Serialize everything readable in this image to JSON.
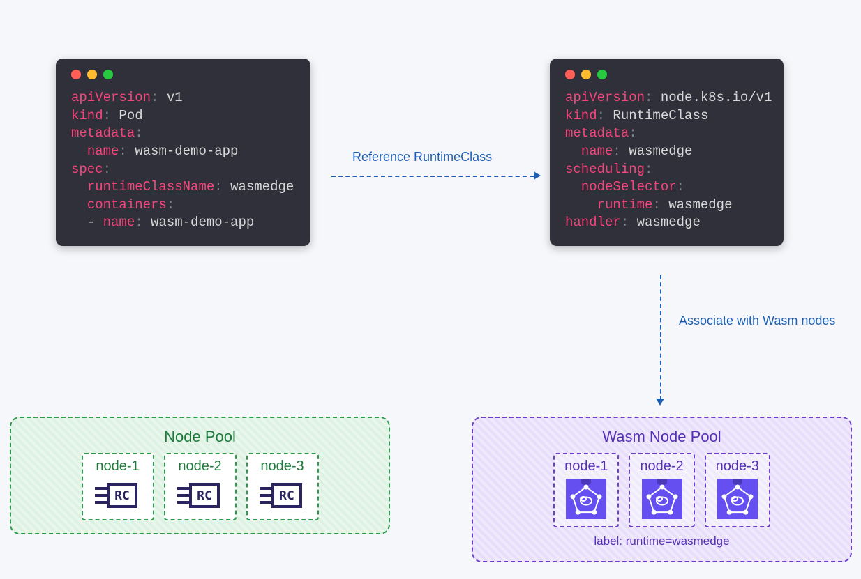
{
  "pod_yaml": {
    "lines": [
      [
        [
          "k",
          "apiVersion"
        ],
        [
          "c",
          ": "
        ],
        [
          "v",
          "v1"
        ]
      ],
      [
        [
          "k",
          "kind"
        ],
        [
          "c",
          ": "
        ],
        [
          "v",
          "Pod"
        ]
      ],
      [
        [
          "k",
          "metadata"
        ],
        [
          "c",
          ":"
        ]
      ],
      [
        [
          "v",
          "  "
        ],
        [
          "k",
          "name"
        ],
        [
          "c",
          ": "
        ],
        [
          "v",
          "wasm-demo-app"
        ]
      ],
      [
        [
          "k",
          "spec"
        ],
        [
          "c",
          ":"
        ]
      ],
      [
        [
          "v",
          "  "
        ],
        [
          "k",
          "runtimeClassName"
        ],
        [
          "c",
          ": "
        ],
        [
          "v",
          "wasmedge"
        ]
      ],
      [
        [
          "v",
          "  "
        ],
        [
          "k",
          "containers"
        ],
        [
          "c",
          ":"
        ]
      ],
      [
        [
          "v",
          "  - "
        ],
        [
          "k",
          "name"
        ],
        [
          "c",
          ": "
        ],
        [
          "v",
          "wasm-demo-app"
        ]
      ]
    ]
  },
  "runtimeclass_yaml": {
    "lines": [
      [
        [
          "k",
          "apiVersion"
        ],
        [
          "c",
          ": "
        ],
        [
          "v",
          "node.k8s.io/v1"
        ]
      ],
      [
        [
          "k",
          "kind"
        ],
        [
          "c",
          ": "
        ],
        [
          "v",
          "RuntimeClass"
        ]
      ],
      [
        [
          "k",
          "metadata"
        ],
        [
          "c",
          ":"
        ]
      ],
      [
        [
          "v",
          "  "
        ],
        [
          "k",
          "name"
        ],
        [
          "c",
          ": "
        ],
        [
          "v",
          "wasmedge"
        ]
      ],
      [
        [
          "k",
          "scheduling"
        ],
        [
          "c",
          ":"
        ]
      ],
      [
        [
          "v",
          "  "
        ],
        [
          "k",
          "nodeSelector"
        ],
        [
          "c",
          ":"
        ]
      ],
      [
        [
          "v",
          "    "
        ],
        [
          "k",
          "runtime"
        ],
        [
          "c",
          ": "
        ],
        [
          "v",
          "wasmedge"
        ]
      ],
      [
        [
          "k",
          "handler"
        ],
        [
          "c",
          ": "
        ],
        [
          "v",
          "wasmedge"
        ]
      ]
    ]
  },
  "arrows": {
    "reference_label": "Reference RuntimeClass",
    "associate_label": "Associate with Wasm nodes"
  },
  "green_pool": {
    "title": "Node Pool",
    "nodes": [
      "node-1",
      "node-2",
      "node-3"
    ],
    "icon_label": "RC"
  },
  "purple_pool": {
    "title": "Wasm Node Pool",
    "nodes": [
      "node-1",
      "node-2",
      "node-3"
    ],
    "caption": "label: runtime=wasmedge"
  }
}
